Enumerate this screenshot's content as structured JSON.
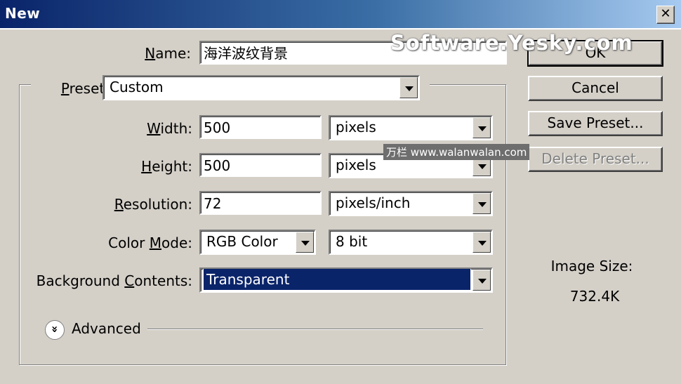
{
  "window": {
    "title": "New",
    "close_glyph": "✕"
  },
  "name": {
    "label_pre": "",
    "label_u": "N",
    "label_post": "ame:",
    "value": "海洋波纹背景"
  },
  "preset": {
    "label_u": "P",
    "label_post": "reset:",
    "value": "Custom"
  },
  "width": {
    "label_u": "W",
    "label_post": "idth:",
    "value": "500",
    "unit": "pixels"
  },
  "height": {
    "label_u": "H",
    "label_post": "eight:",
    "value": "500",
    "unit": "pixels"
  },
  "resolution": {
    "label_u": "R",
    "label_post": "esolution:",
    "value": "72",
    "unit": "pixels/inch"
  },
  "color_mode": {
    "label_pre": "Color ",
    "label_u": "M",
    "label_post": "ode:",
    "value": "RGB Color",
    "bit_depth": "8 bit"
  },
  "background": {
    "label_pre": "Background ",
    "label_u": "C",
    "label_post": "ontents:",
    "value": "Transparent"
  },
  "advanced": {
    "label": "Advanced",
    "icon": "chevron-double-down-icon",
    "glyph": "»"
  },
  "buttons": {
    "ok": "OK",
    "cancel": "Cancel",
    "save_preset": "Save Preset...",
    "delete_preset": "Delete Preset..."
  },
  "image_size": {
    "label": "Image Size:",
    "value": "732.4K"
  },
  "watermarks": {
    "top": "Software.Yesky.com",
    "middle": "万栏 www.walanwalan.com"
  },
  "colors": {
    "title_bar": "#0a246a",
    "dialog_bg": "#d4d0c8",
    "selection": "#0a246a"
  }
}
